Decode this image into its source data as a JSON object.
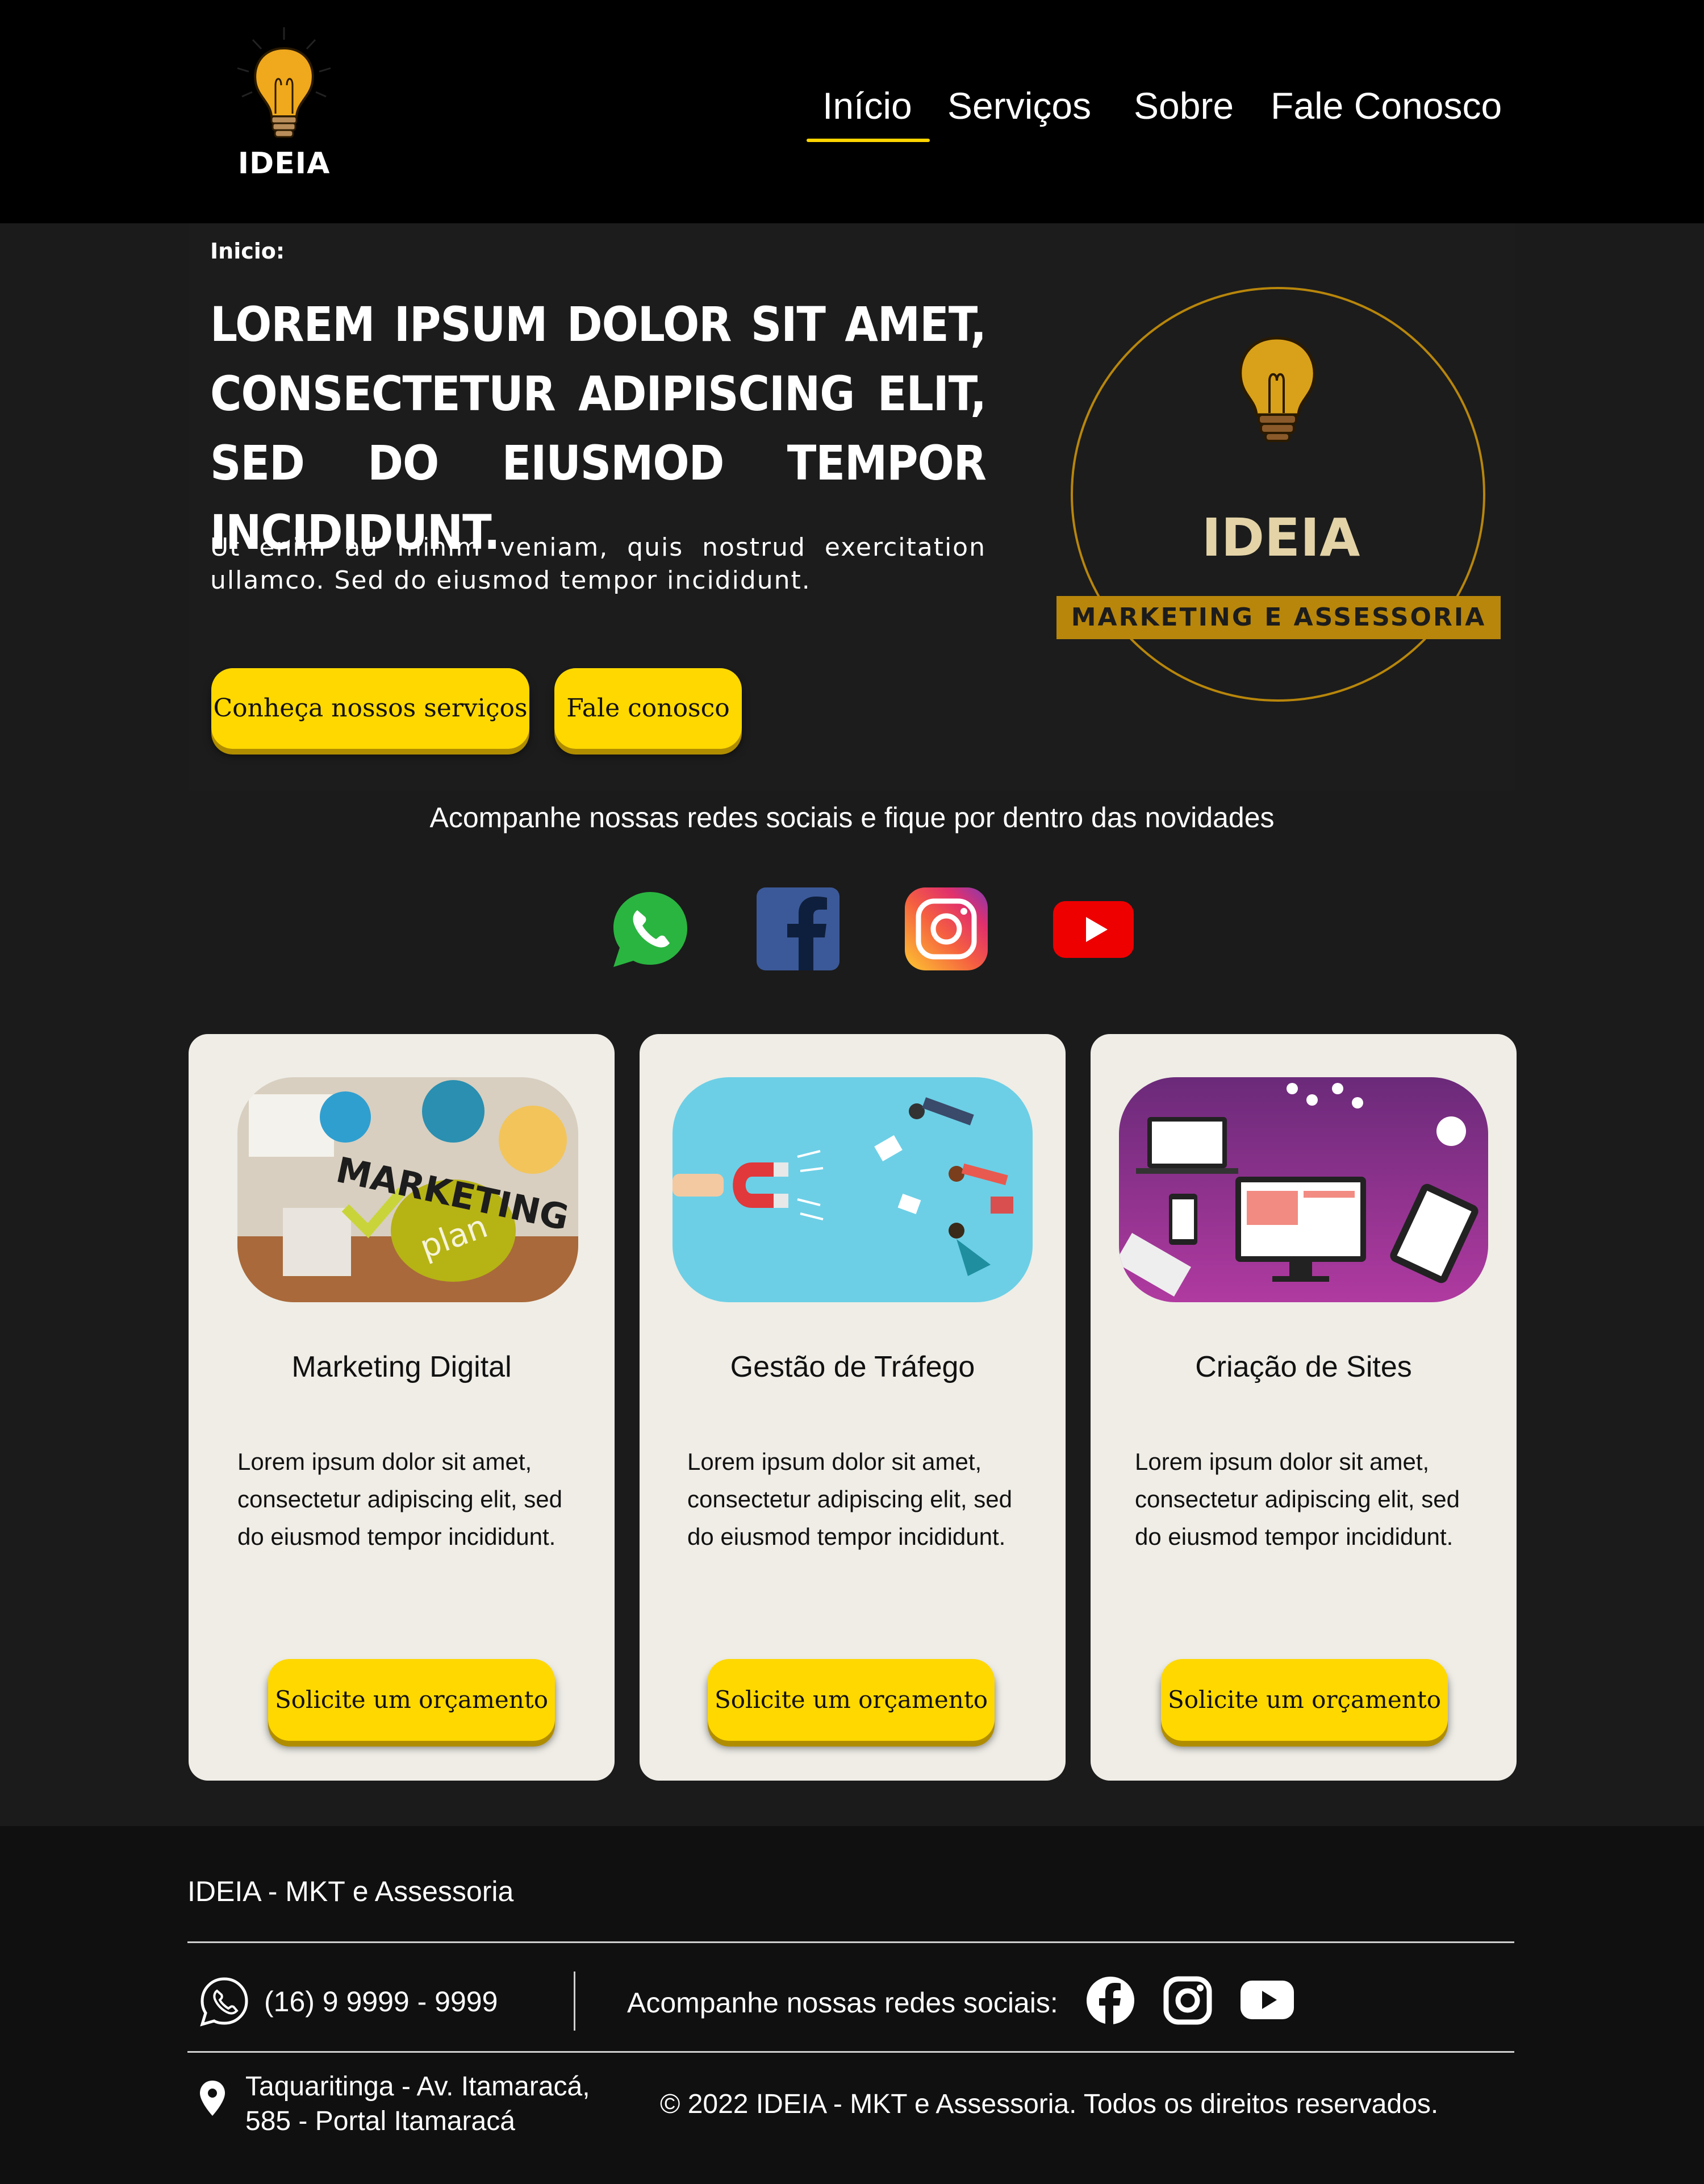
{
  "brand": {
    "logo_text": "IDEIA"
  },
  "nav": {
    "items": [
      {
        "label": "Início",
        "active": true
      },
      {
        "label": "Serviços"
      },
      {
        "label": "Sobre"
      },
      {
        "label": "Fale Conosco"
      }
    ],
    "active_color": "#ffd400"
  },
  "hero": {
    "breadcrumb": "Inicio:",
    "headline": "LOREM IPSUM DOLOR SIT AMET, CONSECTETUR ADIPISCING ELIT, SED DO EIUSMOD TEMPOR INCIDIDUNT.",
    "lead": "Ut enim ad minim veniam, quis nostrud exercitation ullamco. Sed do eiusmod tempor incididunt.",
    "primary_button": "Conheça nossos serviços",
    "secondary_button": "Fale conosco",
    "emblem": {
      "title": "IDEIA",
      "subtitle": "MARKETING E ASSESSORIA"
    }
  },
  "social": {
    "title": "Acompanhe nossas redes sociais e fique por dentro das novidades",
    "icons": [
      "whatsapp-icon",
      "facebook-icon",
      "instagram-icon",
      "youtube-icon"
    ]
  },
  "services": [
    {
      "title": "Marketing Digital",
      "text": "Lorem ipsum dolor sit amet, consectetur adipiscing elit, sed do eiusmod tempor incididunt.",
      "button": "Solicite um orçamento",
      "image_words": [
        "MARKETING",
        "plan"
      ]
    },
    {
      "title": "Gestão de Tráfego",
      "text": "Lorem ipsum dolor sit amet, consectetur adipiscing elit, sed do eiusmod tempor incididunt.",
      "button": "Solicite um orçamento"
    },
    {
      "title": "Criação de Sites",
      "text": "Lorem ipsum dolor sit amet, consectetur adipiscing elit, sed do eiusmod tempor incididunt.",
      "button": "Solicite um orçamento"
    }
  ],
  "footer": {
    "brand": "IDEIA - MKT e Assessoria",
    "phone": "(16) 9 9999 - 9999",
    "social_label": "Acompanhe nossas redes sociais:",
    "address_line1": "Taquaritinga - Av. Itamaracá,",
    "address_line2": "585 - Portal Itamaracá",
    "copyright": "© 2022 IDEIA - MKT e Assessoria. Todos os direitos reservados."
  },
  "colors": {
    "accent": "#ffd800",
    "background": "#1b1b1b",
    "header": "#000000",
    "card": "#efede6",
    "emblem_gold": "#b8860b"
  }
}
